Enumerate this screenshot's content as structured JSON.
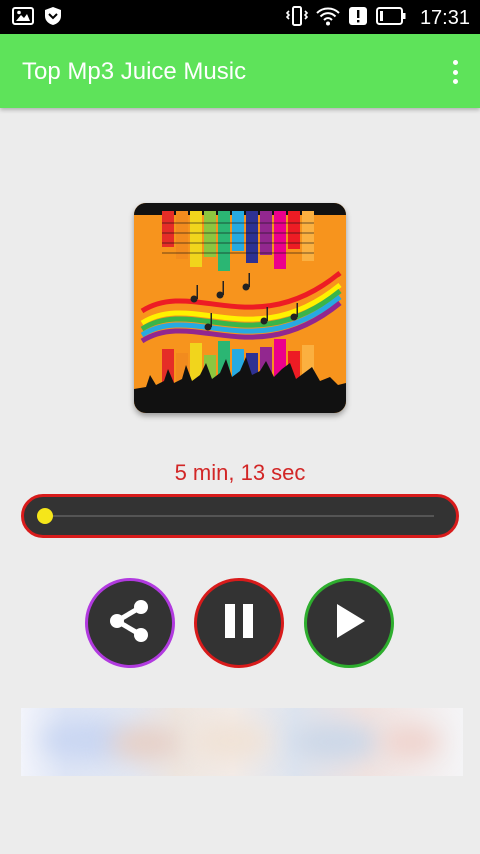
{
  "status_bar": {
    "time": "17:31",
    "left_icons": [
      "image-icon",
      "shield-icon"
    ],
    "right_icons": [
      "vibrate-icon",
      "wifi-icon",
      "alert-icon",
      "battery-icon"
    ]
  },
  "app_bar": {
    "title": "Top Mp3 Juice Music",
    "menu_icon": "more-vert-icon",
    "color": "#5ee35a"
  },
  "player": {
    "duration_text": "5 min, 13 sec",
    "progress": 0.0,
    "controls": [
      {
        "name": "share",
        "icon": "share-icon",
        "ring_color": "#b13adf"
      },
      {
        "name": "pause",
        "icon": "pause-icon",
        "ring_color": "#d81b1b"
      },
      {
        "name": "play",
        "icon": "play-icon",
        "ring_color": "#2eae2e"
      }
    ]
  },
  "colors": {
    "accent_green": "#5ee35a",
    "duration_text": "#d22626",
    "seek_border": "#d81b1b",
    "seek_thumb": "#f5e61a",
    "control_fill": "#333333"
  }
}
